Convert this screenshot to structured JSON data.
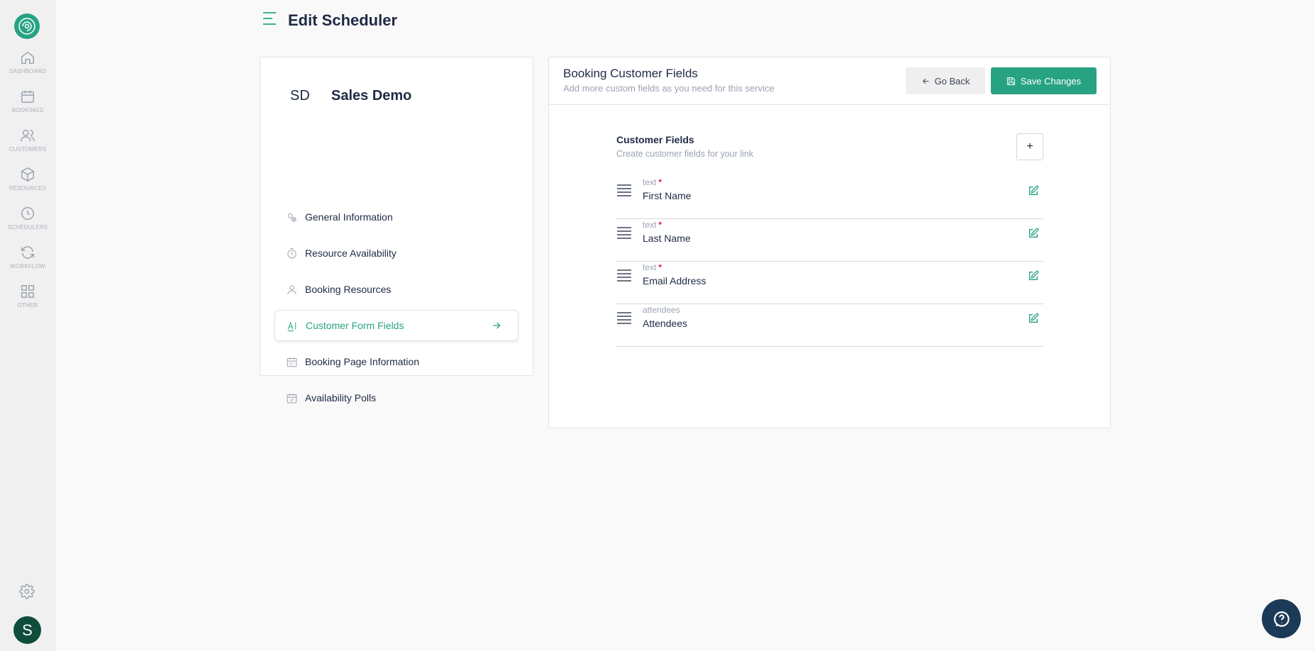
{
  "app": {
    "page_title": "Edit Scheduler",
    "brand_color": "#27a383"
  },
  "sidebar": {
    "items": [
      {
        "label": "DASHBOARD",
        "icon": "home-icon"
      },
      {
        "label": "BOOKINGS",
        "icon": "calendar-icon"
      },
      {
        "label": "CUSTOMERS",
        "icon": "users-icon"
      },
      {
        "label": "RESOURCES",
        "icon": "box-icon"
      },
      {
        "label": "SCHEDULERS",
        "icon": "clock-icon"
      },
      {
        "label": "WORKFLOW",
        "icon": "refresh-icon"
      },
      {
        "label": "OTHER",
        "icon": "grid-icon"
      }
    ],
    "settings_icon": "gear-icon",
    "avatar_initial": "S"
  },
  "service": {
    "initials": "SD",
    "name": "Sales Demo"
  },
  "menu": {
    "items": [
      {
        "label": "General Information",
        "icon": "gears-icon"
      },
      {
        "label": "Resource Availability",
        "icon": "timer-icon"
      },
      {
        "label": "Booking Resources",
        "icon": "person-icon"
      },
      {
        "label": "Customer Form Fields",
        "icon": "text-field-icon",
        "active": true
      },
      {
        "label": "Booking Page Information",
        "icon": "calendar-page-icon"
      },
      {
        "label": "Availability Polls",
        "icon": "calendar-check-icon"
      }
    ]
  },
  "panel": {
    "title": "Booking Customer Fields",
    "subtitle": "Add more custom fields as you need for this service",
    "back_label": "Go Back",
    "save_label": "Save Changes"
  },
  "customer_fields": {
    "title": "Customer Fields",
    "subtitle": "Create customer fields for your link",
    "add_label": "+",
    "fields": [
      {
        "type": "text",
        "required": "*",
        "label": "First Name"
      },
      {
        "type": "text",
        "required": "*",
        "label": "Last Name"
      },
      {
        "type": "text",
        "required": "*",
        "label": "Email Address"
      },
      {
        "type": "attendees",
        "required": "",
        "label": "Attendees"
      }
    ]
  }
}
